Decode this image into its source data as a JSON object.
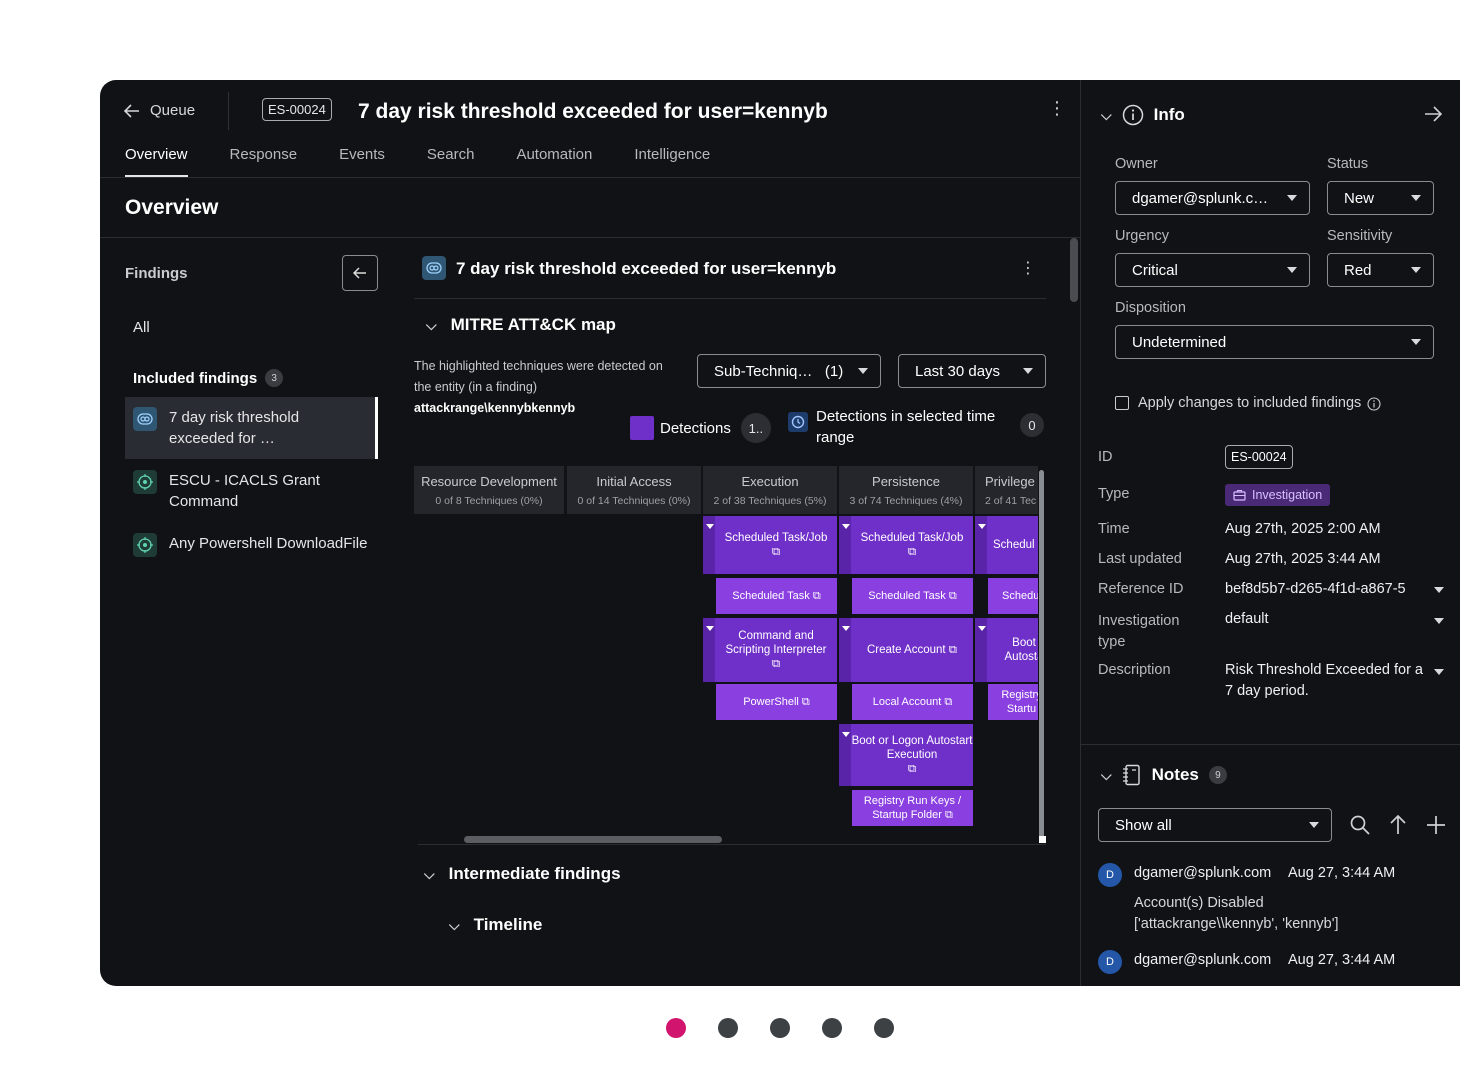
{
  "header": {
    "back_label": "Queue",
    "id_badge": "ES-00024",
    "title": "7 day risk threshold exceeded for user=kennyb",
    "more_icon": "kebab-icon"
  },
  "tabs": [
    {
      "label": "Overview",
      "active": true
    },
    {
      "label": "Response"
    },
    {
      "label": "Events"
    },
    {
      "label": "Search"
    },
    {
      "label": "Automation"
    },
    {
      "label": "Intelligence"
    }
  ],
  "section_title": "Overview",
  "findings": {
    "heading": "Findings",
    "all_label": "All",
    "included_label": "Included findings",
    "included_count": "3",
    "items": [
      {
        "label": "7 day risk threshold exceeded for …",
        "type": "investigation",
        "selected": true
      },
      {
        "label": "ESCU - ICACLS Grant Command",
        "type": "detection"
      },
      {
        "label": "Any Powershell DownloadFile",
        "type": "detection"
      }
    ]
  },
  "center": {
    "title": "7 day risk threshold exceeded for user=kennyb",
    "mitre_title": "MITRE ATT&CK map",
    "desc_line": "The highlighted techniques were detected on the entity (in a finding)",
    "entity": "attackrange\\kennybkennyb",
    "subtech_label": "Sub-Techniq…",
    "subtech_count": "(1)",
    "range_label": "Last 30 days",
    "legend_detections": "Detections",
    "legend_detections_count": "1..",
    "legend_range": "Detections in selected time range",
    "legend_range_count": "0",
    "intermediate_title": "Intermediate findings",
    "timeline_title": "Timeline",
    "columns": [
      {
        "name": "Resource Development",
        "sub": "0 of 8 Techniques (0%)"
      },
      {
        "name": "Initial Access",
        "sub": "0 of 14 Techniques (0%)"
      },
      {
        "name": "Execution",
        "sub": "2 of 38 Techniques (5%)"
      },
      {
        "name": "Persistence",
        "sub": "3 of 74 Techniques (4%)"
      },
      {
        "name": "Privilege",
        "sub": "2 of 41 Tec"
      }
    ],
    "techniques": {
      "exec_1": "Scheduled Task/Job",
      "exec_1_sub": "Scheduled Task",
      "exec_2": "Command and Scripting Interpreter",
      "exec_2_sub": "PowerShell",
      "pers_1": "Scheduled Task/Job",
      "pers_1_sub": "Scheduled Task",
      "pers_2": "Create Account",
      "pers_2_sub": "Local Account",
      "pers_3": "Boot or Logon Autostart Execution",
      "pers_3_sub": "Registry Run Keys / Startup Folder",
      "priv_1": "Schedul",
      "priv_1_sub": "Schedu",
      "priv_2": "Boot Autosta",
      "priv_2_sub": "Registry Startu"
    }
  },
  "info": {
    "heading": "Info",
    "owner_label": "Owner",
    "owner_value": "dgamer@splunk.c…",
    "status_label": "Status",
    "status_value": "New",
    "urgency_label": "Urgency",
    "urgency_value": "Critical",
    "sensitivity_label": "Sensitivity",
    "sensitivity_value": "Red",
    "disposition_label": "Disposition",
    "disposition_value": "Undetermined",
    "apply_label": "Apply changes to included findings",
    "id_label": "ID",
    "id_value": "ES-00024",
    "type_label": "Type",
    "type_value": "Investigation",
    "time_label": "Time",
    "time_value": "Aug 27th, 2025 2:00 AM",
    "updated_label": "Last updated",
    "updated_value": "Aug 27th, 2025 3:44 AM",
    "ref_label": "Reference ID",
    "ref_value": "bef8d5b7-d265-4f1d-a867-5",
    "invtype_label": "Investigation type",
    "invtype_value": "default",
    "desc_label": "Description",
    "desc_value": "Risk Threshold Exceeded for a 7 day period."
  },
  "notes": {
    "heading": "Notes",
    "count": "9",
    "filter_value": "Show all",
    "entries": [
      {
        "initial": "D",
        "author": "dgamer@splunk.com",
        "time": "Aug 27, 3:44 AM",
        "text": "Account(s) Disabled ['attackrange\\\\kennyb', 'kennyb']"
      },
      {
        "initial": "D",
        "author": "dgamer@splunk.com",
        "time": "Aug 27, 3:44 AM"
      }
    ]
  },
  "colors": {
    "technique": "#6f2fc9",
    "subtechnique": "#8a3fe0",
    "active_dot": "#d1146e",
    "background": "#111215"
  },
  "carousel": {
    "count": 5,
    "active": 0
  }
}
